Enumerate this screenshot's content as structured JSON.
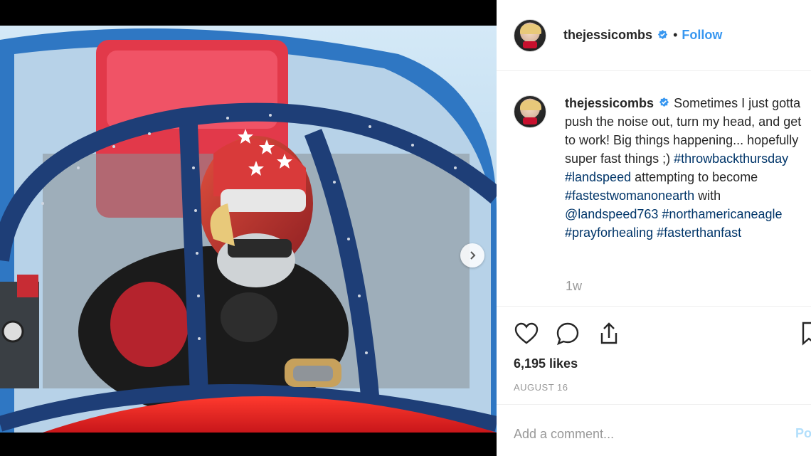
{
  "post": {
    "username": "thejessicombs",
    "separator": "•",
    "follow_label": "Follow",
    "caption_username": "thejessicombs",
    "caption_text": "Sometimes I just gotta push the noise out, turn my head, and get to work! Big things happening... hopefully super fast things ;) ",
    "hashtags": {
      "throwback": "#throwbackthursday",
      "landspeed": "#landspeed",
      "mid_text": " attempting to become ",
      "fastest": "#fastestwomanonearth",
      "with_text": " with ",
      "mention": "@landspeed763",
      "eagle": "#northamericaneagle",
      "prayfor": "#prayforhealing",
      "faster": "#fasterthanfast"
    },
    "time_ago": "1w",
    "likes": "6,195 likes",
    "date": "AUGUST 16",
    "comment_placeholder": "Add a comment...",
    "post_button": "Po"
  },
  "icons": {
    "like": "heart-icon",
    "comment": "comment-icon",
    "share": "share-icon",
    "save": "bookmark-icon",
    "verified": "verified-badge-icon",
    "next": "chevron-right-icon"
  },
  "colors": {
    "accent": "#3897f0",
    "hashtag": "#003569",
    "muted": "#999999"
  }
}
